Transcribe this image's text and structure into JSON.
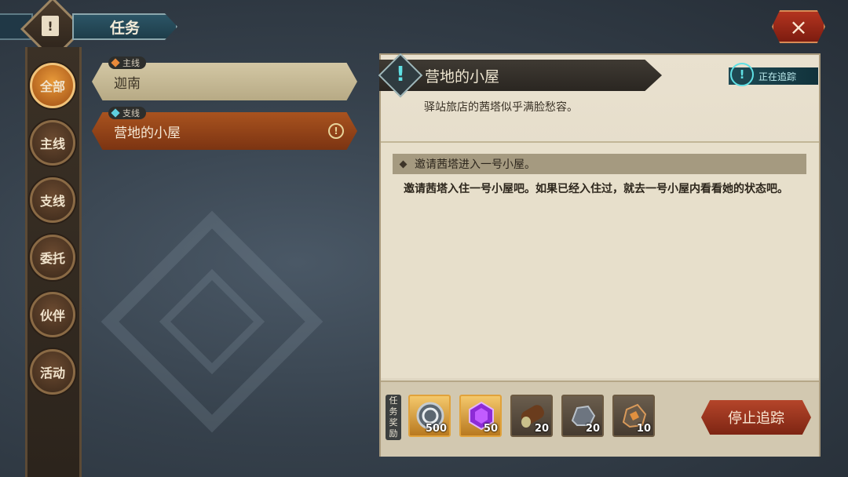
{
  "header": {
    "title": "任务",
    "close_icon": "×"
  },
  "categories": [
    {
      "label": "全部",
      "active": true
    },
    {
      "label": "主线"
    },
    {
      "label": "支线"
    },
    {
      "label": "委托"
    },
    {
      "label": "伙伴"
    },
    {
      "label": "活动"
    }
  ],
  "quests": [
    {
      "tag": "主线",
      "tag_color": "#e98a3a",
      "title": "迦南"
    },
    {
      "tag": "支线",
      "tag_color": "#5fd0e0",
      "title": "营地的小屋"
    }
  ],
  "detail": {
    "title": "营地的小屋",
    "tracking_label": "正在追踪",
    "subtitle": "驿站旅店的茜塔似乎满脸愁容。",
    "objective": "邀请茜塔进入一号小屋。",
    "description": "邀请茜塔入住一号小屋吧。如果已经入住过，就去一号小屋内看看她的状态吧。"
  },
  "rewards": {
    "label": "任务奖励",
    "items": [
      {
        "icon": "coin-icon",
        "qty": "500"
      },
      {
        "icon": "purple-gem-icon",
        "qty": "50"
      },
      {
        "icon": "wood-log-icon",
        "qty": "20"
      },
      {
        "icon": "stone-ore-icon",
        "qty": "20"
      },
      {
        "icon": "copper-ore-icon",
        "qty": "10"
      }
    ]
  },
  "stop_button": "停止追踪",
  "colors": {
    "accent": "#a9531f",
    "tracking": "#5fe0e4"
  }
}
